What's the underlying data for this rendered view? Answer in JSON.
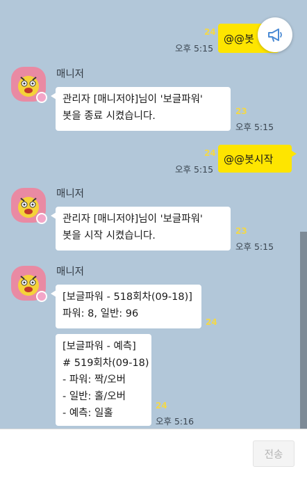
{
  "messages": {
    "out1": {
      "text": "@@봇",
      "unread": "24",
      "time": "오후 5:15"
    },
    "in1": {
      "sender": "매니저",
      "text": "관리자 [매니저야]님이 '보글파워'\n봇을 종료 시켰습니다.",
      "unread": "23",
      "time": "오후 5:15"
    },
    "out2": {
      "text": "@@봇시작",
      "unread": "24",
      "time": "오후 5:15"
    },
    "in2": {
      "sender": "매니저",
      "text": "관리자 [매니저야]님이 '보글파워'\n봇을 시작 시켰습니다.",
      "unread": "23",
      "time": "오후 5:15"
    },
    "in3": {
      "sender": "매니저",
      "text1": "[보글파워 - 518회차(09-18)]\n파워: 8, 일반: 96",
      "unread1": "24",
      "text2": "[보글파워 - 예측]\n# 519회차(09-18)\n- 파워: 짝/오버\n- 일반: 홀/오버\n- 예측: 일홀",
      "unread2": "24",
      "time": "오후 5:16"
    }
  },
  "input": {
    "send_label": "전송",
    "placeholder": ""
  },
  "icons": {
    "notice": "megaphone-icon",
    "avatar": "profile-avatar",
    "crown": "crown-badge-icon"
  },
  "colors": {
    "background": "#b2c7d9",
    "my_bubble": "#fee500",
    "their_bubble": "#ffffff",
    "unread": "#f2d84a"
  }
}
